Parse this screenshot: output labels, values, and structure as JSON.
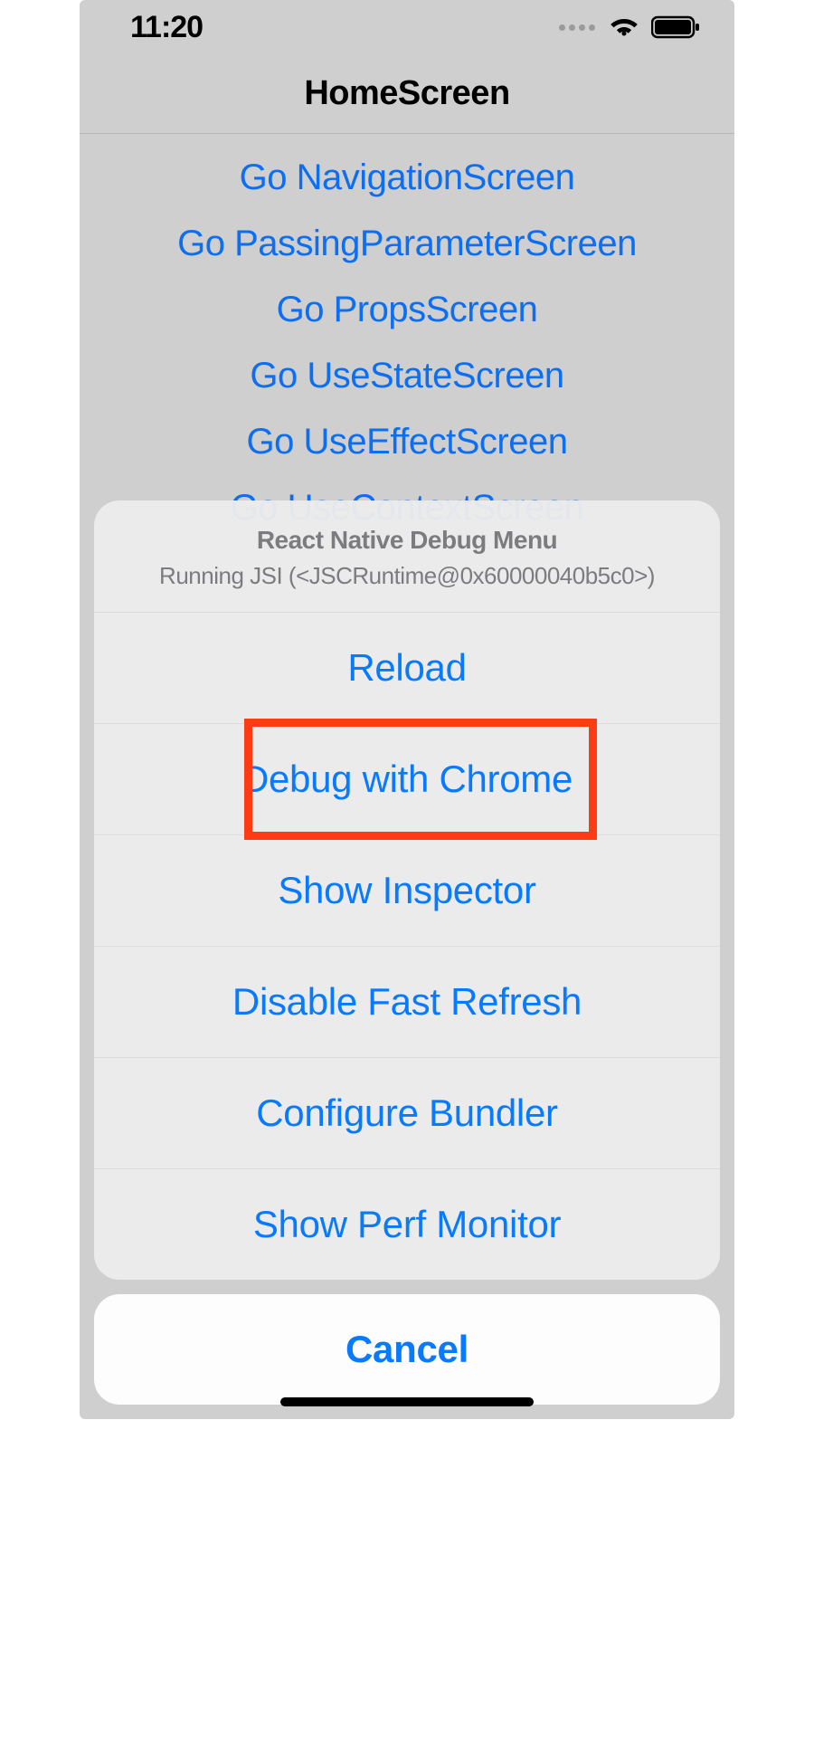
{
  "status_bar": {
    "time": "11:20"
  },
  "nav": {
    "title": "HomeScreen"
  },
  "links": [
    "Go NavigationScreen",
    "Go PassingParameterScreen",
    "Go PropsScreen",
    "Go UseStateScreen",
    "Go UseEffectScreen",
    "Go UseContextScreen"
  ],
  "sheet": {
    "title": "React Native Debug Menu",
    "subtitle": "Running JSI (<JSCRuntime@0x60000040b5c0>)",
    "items": [
      "Reload",
      "Debug with Chrome",
      "Show Inspector",
      "Disable Fast Refresh",
      "Configure Bundler",
      "Show Perf Monitor"
    ],
    "cancel": "Cancel",
    "highlighted_index": 1
  }
}
